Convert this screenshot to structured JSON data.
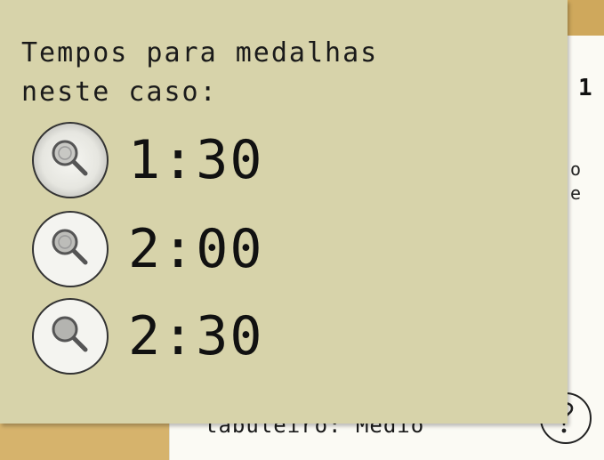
{
  "background": {
    "peek_number": "1",
    "peek_text_1": "o",
    "peek_text_2": "e",
    "difficulty_text": "tabuleiro: Médio",
    "help_icon": "question-mark-icon"
  },
  "medal_note": {
    "title": "Tempos para medalhas\nneste caso:",
    "medals": [
      {
        "icon": "magnifying-glass-icon",
        "time": "1:30"
      },
      {
        "icon": "magnifying-glass-icon",
        "time": "2:00"
      },
      {
        "icon": "magnifying-glass-icon",
        "time": "2:30"
      }
    ]
  },
  "colors": {
    "note": "#d7d3aa",
    "paper": "#fbfaf4",
    "table": "#d9b56e"
  }
}
